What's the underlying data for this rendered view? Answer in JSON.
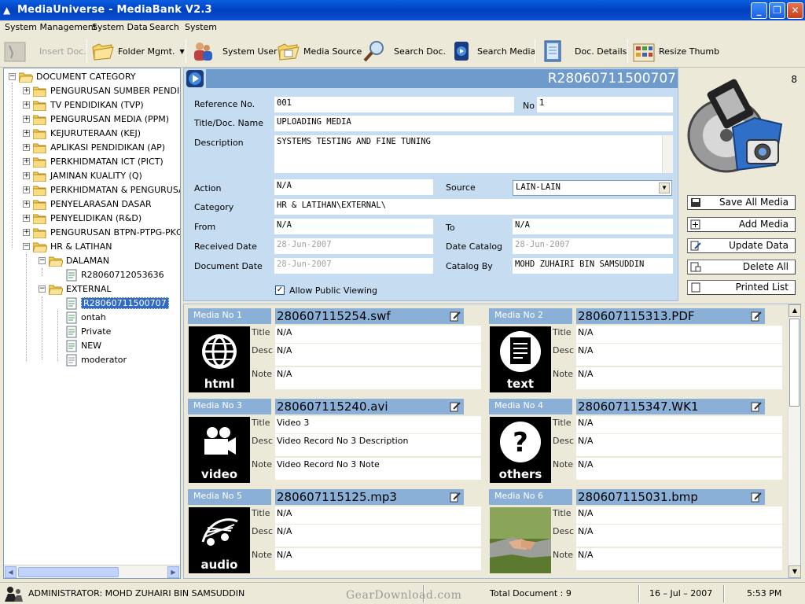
{
  "window": {
    "title": "MediaUniverse - MediaBank V2.3"
  },
  "menu": [
    "System Management",
    "System Data",
    "Search",
    "System"
  ],
  "toolbar": [
    {
      "label": "Insert Doc.",
      "icon": "insert-doc-icon",
      "enabled": false
    },
    {
      "label": "Folder Mgmt.",
      "icon": "folder-icon",
      "enabled": true
    },
    {
      "label": "System User",
      "icon": "users-icon",
      "enabled": true
    },
    {
      "label": "Media Source",
      "icon": "folder-source-icon",
      "enabled": true
    },
    {
      "label": "Search Doc.",
      "icon": "magnifier-icon",
      "enabled": true
    },
    {
      "label": "Search Media",
      "icon": "search-media-icon",
      "enabled": true
    },
    {
      "label": "Doc. Details",
      "icon": "notebook-icon",
      "enabled": true
    },
    {
      "label": "Resize Thumb",
      "icon": "resize-thumb-icon",
      "enabled": true
    }
  ],
  "tree": {
    "root": "DOCUMENT CATEGORY",
    "categories": [
      "PENGURUSAN SUMBER PENDIDI",
      "TV PENDIDIKAN (TVP)",
      "PENGURUSAN MEDIA (PPM)",
      "KEJURUTERAAN (KEJ)",
      "APLIKASI PENDIDIKAN (AP)",
      "PERKHIDMATAN ICT (PICT)",
      "JAMINAN KUALITY (Q)",
      "PERKHIDMATAN & PENGURUSA",
      "PENYELARASAN DASAR",
      "PENYELIDIKAN (R&D)",
      "PENGURUSAN BTPN-PTPG-PKG",
      "HR & LATIHAN"
    ],
    "hr_children": {
      "dalaman": "DALAMAN",
      "dalaman_doc": "R28060712053636",
      "external": "EXTERNAL",
      "external_docs": [
        "R28060711500707",
        "ontah",
        "Private",
        "NEW",
        "moderator"
      ]
    }
  },
  "document": {
    "id": "R28060711500707",
    "labels": {
      "reference": "Reference No.",
      "no": "No",
      "title": "Title/Doc. Name",
      "description": "Description",
      "action": "Action",
      "source": "Source",
      "category": "Category",
      "from": "From",
      "to": "To",
      "received": "Received Date",
      "date_catalog": "Date Catalog",
      "document_date": "Document Date",
      "catalog_by": "Catalog By",
      "public": "Allow Public Viewing"
    },
    "values": {
      "reference": "001",
      "no": "1",
      "title": "UPLOADING MEDIA",
      "description": "SYSTEMS TESTING AND FINE TUNING",
      "action": "N/A",
      "source": "LAIN-LAIN",
      "category": "HR & LATIHAN\\EXTERNAL\\",
      "from": "N/A",
      "to": "N/A",
      "received": "28-Jun-2007",
      "date_catalog": "28-Jun-2007",
      "document_date": "28-Jun-2007",
      "catalog_by": "MOHD ZUHAIRI BIN SAMSUDDIN",
      "public_checked": true
    }
  },
  "logo_count": "8",
  "actions": [
    "Save All Media",
    "Add Media",
    "Update Data",
    "Delete All",
    "Printed List"
  ],
  "media_labels": {
    "title": "Title",
    "desc": "Desc",
    "note": "Note"
  },
  "media": [
    {
      "tag": "Media No 1",
      "file": "280607115254.swf",
      "thumb": "html",
      "title": "N/A",
      "desc": "N/A",
      "note": "N/A"
    },
    {
      "tag": "Media No 2",
      "file": "280607115313.PDF",
      "thumb": "text",
      "title": "N/A",
      "desc": "N/A",
      "note": "N/A"
    },
    {
      "tag": "Media No 3",
      "file": "280607115240.avi",
      "thumb": "video",
      "title": "Video 3",
      "desc": "Video Record No 3 Description",
      "note": "Video Record No 3 Note"
    },
    {
      "tag": "Media No 4",
      "file": "280607115347.WK1",
      "thumb": "others",
      "title": "N/A",
      "desc": "N/A",
      "note": "N/A"
    },
    {
      "tag": "Media No 5",
      "file": "280607115125.mp3",
      "thumb": "audio",
      "title": "N/A",
      "desc": "N/A",
      "note": "N/A"
    },
    {
      "tag": "Media No 6",
      "file": "280607115031.bmp",
      "thumb": "photo",
      "title": "N/A",
      "desc": "N/A",
      "note": "N/A"
    }
  ],
  "status": {
    "user": "ADMINISTRATOR: MOHD ZUHAIRI BIN SAMSUDDIN",
    "watermark": "GearDownload.com",
    "total": "Total Document : 9",
    "date": "16 – Jul – 2007",
    "time": "5:53 PM"
  },
  "colors": {
    "title_bar": "#0a4fd0",
    "detail_bg": "#c6dcf0",
    "header_blue": "#6e9acc",
    "media_tag": "#8ab0d8",
    "selection": "#316ac5"
  }
}
